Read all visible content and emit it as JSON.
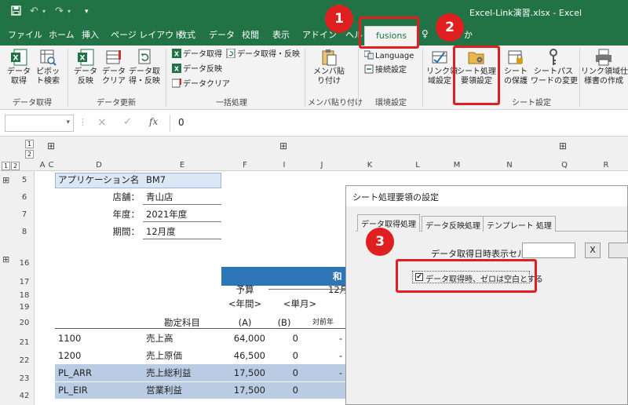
{
  "titlebar": {
    "window_title": "Excel-Link演習.xlsx  -  Excel",
    "save_icon": "save-icon",
    "undo_icon": "undo-icon",
    "redo_icon": "redo-icon",
    "accent": "#217346"
  },
  "tabs": [
    {
      "label": "ファイル"
    },
    {
      "label": "ホーム"
    },
    {
      "label": "挿入"
    },
    {
      "label": "ページ レイアウト"
    },
    {
      "label": "数式"
    },
    {
      "label": "データ"
    },
    {
      "label": "校閲"
    },
    {
      "label": "表示"
    },
    {
      "label": "アドイン"
    },
    {
      "label": "ヘル"
    },
    {
      "label": "fusions"
    },
    {
      "label": "か"
    }
  ],
  "ribbon": {
    "data_get_btn": "データ\n取得",
    "pivot_btn": "ピボッ\nト検索",
    "group_data_get": "データ取得",
    "data_reflect_btn": "データ\n反映",
    "data_clear_btn": "データ\nクリア",
    "data_get_reflect_btn": "データ取\n得・反映",
    "group_data_update": "データ更新",
    "batch_get": "データ取得",
    "batch_get_reflect": "データ取得・反映",
    "batch_reflect": "データ反映",
    "batch_clear": "データクリア",
    "group_batch": "一括処理",
    "member_paste_btn": "メンバ貼\nり付け",
    "group_member": "メンバ貼り付け",
    "language_btn": "Language",
    "connect_btn": "接続設定",
    "group_env": "環境設定",
    "link_area_btn": "リンク領\n域設定",
    "sheet_proc_btn": "シート処理\n要領設定",
    "sheet_protect_btn": "シート\nの保護",
    "sheet_pw_btn": "シートパス\nワードの変更",
    "link_doc_btn": "リンク領域仕\n様書の作成",
    "group_sheet": "シート設定"
  },
  "formula_bar": {
    "name_box": "",
    "cancel": "×",
    "enter": "✓",
    "fx": "fx",
    "value": "0"
  },
  "columns": [
    "A",
    "C",
    "D",
    "E",
    "F",
    "I",
    "J",
    "K",
    "L",
    "M",
    "N",
    "Q",
    "R"
  ],
  "level_buttons": [
    "1",
    "2",
    "1",
    "2"
  ],
  "rows": [
    "5",
    "6",
    "7",
    "8",
    "16",
    "17",
    "18",
    "19",
    "20",
    "21",
    "22",
    "23",
    "42"
  ],
  "info": {
    "app_label": "アプリケーション名",
    "app_value": "BM7",
    "store_label": "店舗：",
    "store_value": "青山店",
    "year_label": "年度：",
    "year_value": "2021年度",
    "period_label": "期間：",
    "period_value": "12月度"
  },
  "table": {
    "header_merged": "和",
    "budget": "予算",
    "annual": "<年間>",
    "a": "(A)",
    "month_hdr": "12月",
    "single_month": "<単月>",
    "b": "(B)",
    "yoy": "対前年",
    "account_header": "勘定科目",
    "rows": [
      {
        "code": "1100",
        "name": "売上高",
        "annual": "64,000",
        "monthly": "0",
        "yoy": "-"
      },
      {
        "code": "1200",
        "name": "売上原価",
        "annual": "46,500",
        "monthly": "0",
        "yoy": "-"
      },
      {
        "code": "PL_ARR",
        "name": "売上総利益",
        "annual": "17,500",
        "monthly": "0",
        "yoy": "-"
      },
      {
        "code": "PL_EIR",
        "name": "営業利益",
        "annual": "17,500",
        "monthly": "0",
        "yoy": "-"
      }
    ]
  },
  "dialog": {
    "title": "シート処理要領の設定",
    "tabs": [
      "データ取得処理",
      "データ反映処理",
      "テンプレート 処理"
    ],
    "datetime_label": "データ取得日時表示セル:",
    "clear_btn": "X",
    "zero_blank_checkbox": "データ取得時、ゼロは空白とする",
    "zero_blank_checked": true
  },
  "callouts": {
    "one": "1",
    "two": "2",
    "three": "3",
    "color": "#e02020"
  }
}
